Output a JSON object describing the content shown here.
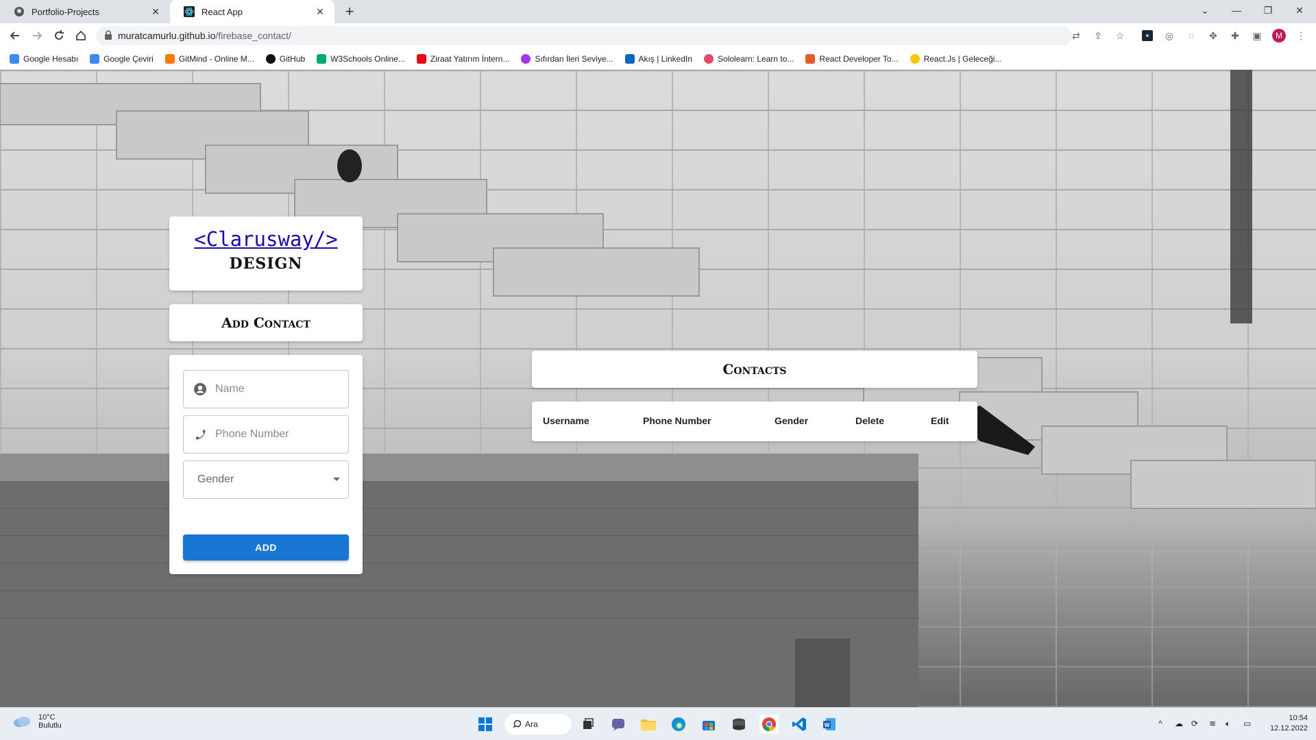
{
  "browser": {
    "tabs": [
      {
        "title": "Portfolio-Projects",
        "active": false
      },
      {
        "title": "React App",
        "active": true
      }
    ],
    "url_host": "muratcamurlu.github.io",
    "url_path": "/firebase_contact/",
    "profile_initial": "M",
    "bookmarks": [
      {
        "label": "Google Hesabı",
        "color": "#4285f4"
      },
      {
        "label": "Google Çeviri",
        "color": "#4285f4"
      },
      {
        "label": "GitMind - Online M...",
        "color": "#f57c00"
      },
      {
        "label": "GitHub",
        "color": "#111111"
      },
      {
        "label": "W3Schools Online...",
        "color": "#04aa6d"
      },
      {
        "label": "Ziraat Yatırım İntern...",
        "color": "#e30a17"
      },
      {
        "label": "Sıfırdan İleri Seviye...",
        "color": "#a435f0"
      },
      {
        "label": "Akış | LinkedIn",
        "color": "#0a66c2"
      },
      {
        "label": "Sololearn: Learn to...",
        "color": "#e14a6d"
      },
      {
        "label": "React Developer To...",
        "color": "#e25d2b"
      },
      {
        "label": "React.Js | Geleceği...",
        "color": "#f7c600"
      }
    ]
  },
  "app": {
    "logo_link": "<Clarusway/>",
    "logo_sub": "DESIGN",
    "add_contact_title": "Add Contact",
    "form": {
      "name_placeholder": "Name",
      "phone_placeholder": "Phone Number",
      "gender_label": "Gender",
      "add_button": "ADD"
    },
    "contacts_title": "Contacts",
    "table_headers": [
      "Username",
      "Phone Number",
      "Gender",
      "Delete",
      "Edit"
    ],
    "accent_color": "#1976d2"
  },
  "taskbar": {
    "weather_temp": "10°C",
    "weather_desc": "Bulutlu",
    "search_label": "Ara",
    "time": "10:54",
    "date": "12.12.2022"
  }
}
